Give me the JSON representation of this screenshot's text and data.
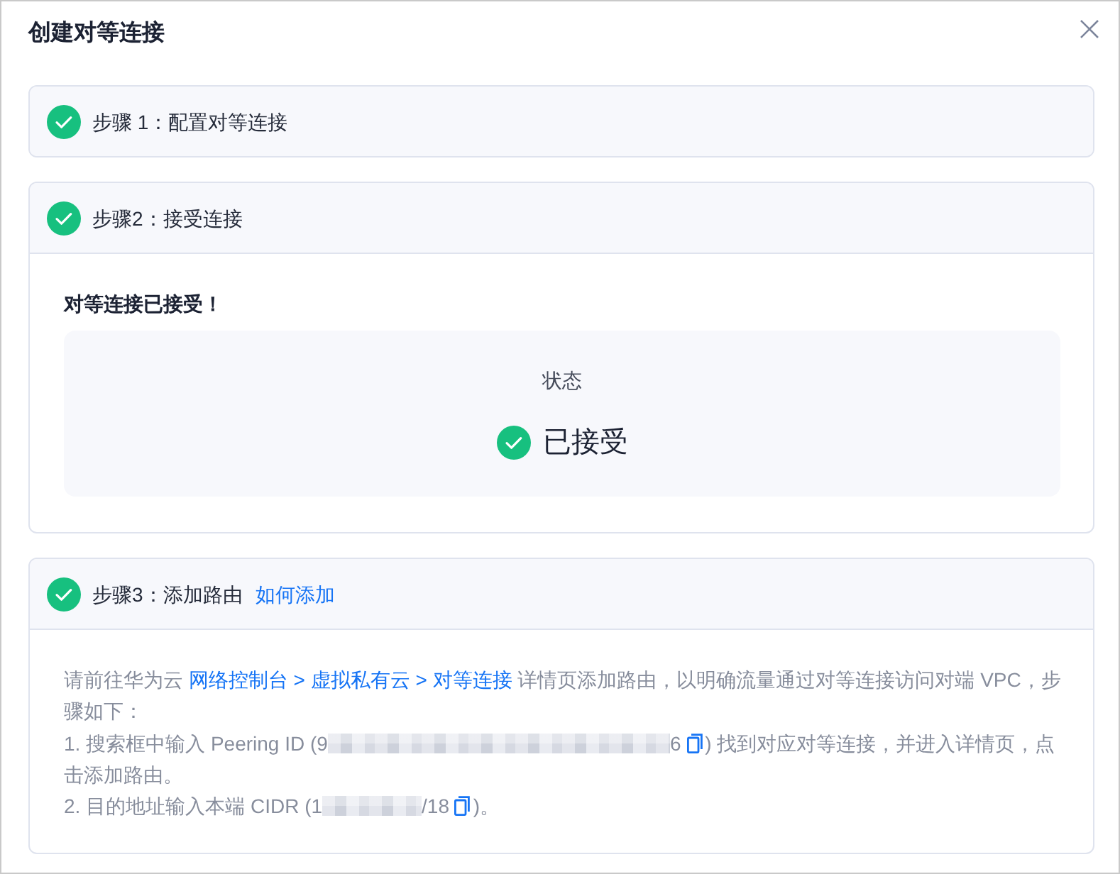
{
  "dialog": {
    "title": "创建对等连接"
  },
  "steps": [
    {
      "label": "步骤 1：配置对等连接",
      "completed": true,
      "expanded": false
    },
    {
      "kind": "status",
      "label": "步骤2：接受连接",
      "completed": true,
      "expanded": true,
      "message": "对等连接已接受！",
      "status": {
        "label": "状态",
        "value": "已接受"
      }
    },
    {
      "kind": "instructions",
      "label": "步骤3：添加路由",
      "help_link": "如何添加",
      "completed": true,
      "expanded": true,
      "paragraphs": [
        [
          {
            "kind": "text",
            "text": "请前往华为云 "
          },
          {
            "kind": "link",
            "text": "网络控制台 > 虚拟私有云 > 对等连接"
          },
          {
            "kind": "text",
            "text": " 详情页添加路由，以明确流量通过对等连接访问对端 VPC，步骤如下："
          }
        ],
        [
          {
            "kind": "text",
            "text": "1. 搜索框中输入 Peering ID (9"
          },
          {
            "kind": "redacted"
          },
          {
            "kind": "text",
            "text": "6 "
          },
          {
            "kind": "copy"
          },
          {
            "kind": "text",
            "text": ") 找到对应对等连接，并进入详情页，点击添加路由。"
          }
        ],
        [
          {
            "kind": "text",
            "text": "2. 目的地址输入本端 CIDR (1"
          },
          {
            "kind": "redacted"
          },
          {
            "kind": "text",
            "text": "/18 "
          },
          {
            "kind": "copy"
          },
          {
            "kind": "text",
            "text": ")。"
          }
        ]
      ]
    }
  ]
}
